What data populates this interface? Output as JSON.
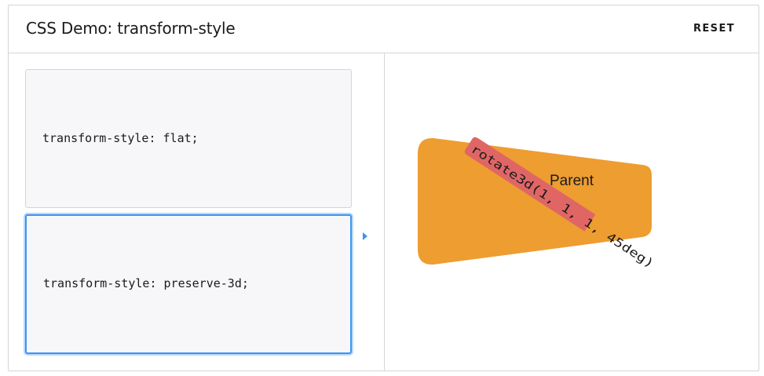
{
  "header": {
    "title": "CSS Demo: transform-style",
    "reset_label": "RESET"
  },
  "examples": [
    {
      "code": "transform-style: flat;",
      "selected": false
    },
    {
      "code": "transform-style: preserve-3d;",
      "selected": true
    }
  ],
  "output": {
    "parent_label": "Parent",
    "child_label": "rotate3d(1, 1, 1, 45deg)",
    "parent_color": "#ee9d31",
    "child_color": "#e06666"
  },
  "colors": {
    "accent": "#3c95ee",
    "border": "#d6d6d6",
    "example_bg": "#f7f7f9"
  }
}
